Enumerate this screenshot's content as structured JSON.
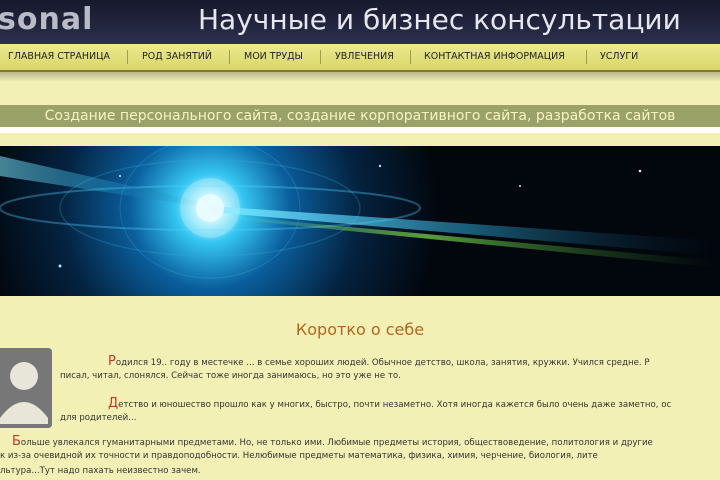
{
  "header": {
    "logo_text": "sonal",
    "site_title": "Научные и бизнес консультации"
  },
  "nav": {
    "items": [
      {
        "label": "ГЛАВНАЯ СТРАНИЦА"
      },
      {
        "label": "РОД ЗАНЯТИЙ"
      },
      {
        "label": "МОИ ТРУДЫ"
      },
      {
        "label": "УВЛЕЧЕНИЯ"
      },
      {
        "label": "КОНТАКТНАЯ ИНФОРМАЦИЯ"
      },
      {
        "label": "УСЛУГИ"
      }
    ]
  },
  "slogan": "Создание персонального сайта, создание корпоративного сайта, разработка сайтов",
  "section": {
    "title": "Коротко о себе",
    "p1": {
      "dropcap": "Р",
      "line1": "одился 19.. году в местечке ... в семье хороших людей. Обычное детство, школа, занятия, кружки. Учился средне. Р",
      "line2": "писал, читал, слонялся. Сейчас тоже иногда занимаюсь, но это уже не то."
    },
    "p2": {
      "dropcap": "Д",
      "line1": "етство и юношество прошло как у многих, быстро, почти незаметно. Хотя иногда кажется было очень даже заметно, ос",
      "line2": "для родителей..."
    },
    "p3": {
      "dropcap": "Б",
      "line1": "ольше увлекался гуманитарными предметами. Но, не только ими. Любимые предметы история, обществоведение, политология и другие",
      "line2": "к из-за очевидной их точности и правдоподобности. Нелюбимые предметы математика, физика, химия, черчение, биология, лите",
      "line3": "льтура...Тут надо пахать неизвестно зачем."
    }
  },
  "colors": {
    "page_bg": "#f3f0b6",
    "header_bg": "#1b1e33",
    "nav_bg": "#e6e47e",
    "slogan_bg": "#9aa268",
    "title_orange": "#b5651d",
    "dropcap_red": "#c0392b"
  },
  "icons": {
    "avatar": "user-silhouette-icon"
  }
}
